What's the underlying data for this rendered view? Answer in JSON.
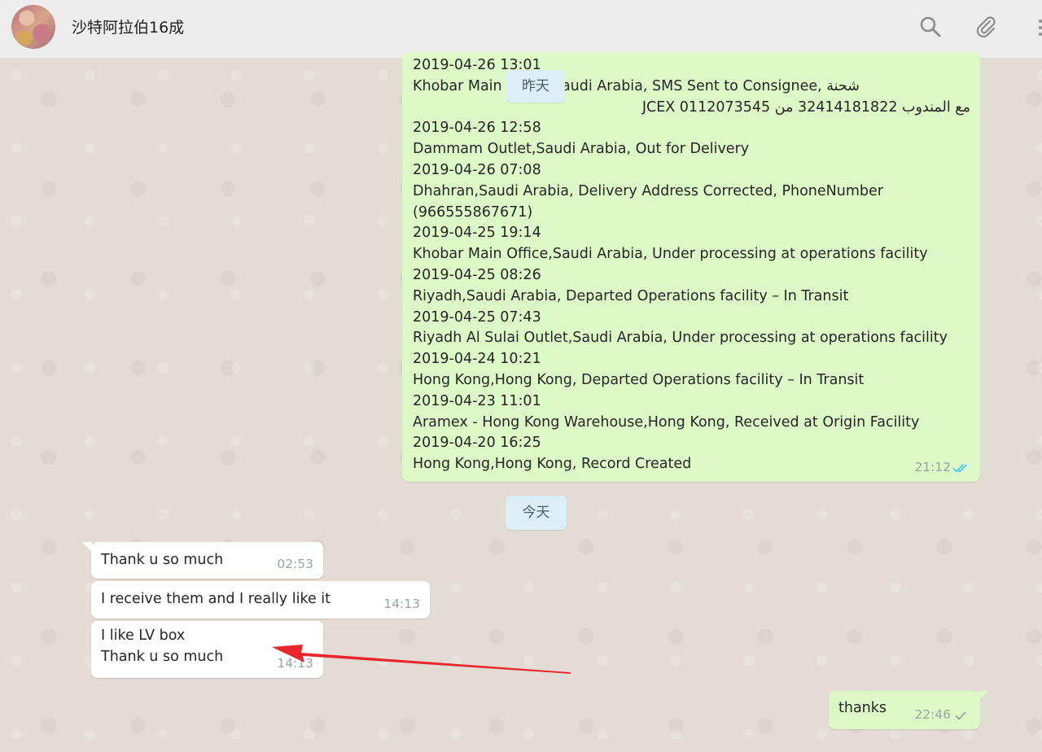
{
  "header": {
    "contact_name": "沙特阿拉伯16成",
    "icons": [
      "search-icon",
      "attach-icon"
    ]
  },
  "date_chips": {
    "yesterday": "昨天",
    "today": "今天"
  },
  "tracking_message": {
    "lines": [
      "2019-04-26 13:01",
      "Khobar Main Office,Saudi Arabia, SMS Sent to Consignee, شحنة",
      "مع المندوب 32414181822 من JCEX 0112073545",
      "2019-04-26 12:58",
      "Dammam Outlet,Saudi Arabia, Out for Delivery",
      "2019-04-26 07:08",
      "Dhahran,Saudi Arabia, Delivery Address Corrected, PhoneNumber",
      "(966555867671)",
      "2019-04-25 19:14",
      "Khobar Main Office,Saudi Arabia, Under processing at operations facility",
      "2019-04-25 08:26",
      "Riyadh,Saudi Arabia, Departed Operations facility – In Transit",
      "2019-04-25 07:43",
      "Riyadh Al Sulai Outlet,Saudi Arabia, Under processing at operations facility",
      "2019-04-24 10:21",
      "Hong Kong,Hong Kong, Departed Operations facility – In Transit",
      "2019-04-23 11:01",
      "Aramex - Hong Kong Warehouse,Hong Kong, Received at Origin Facility",
      "2019-04-20 16:25",
      "Hong Kong,Hong Kong, Record Created"
    ],
    "time": "21:12",
    "status": "read"
  },
  "incoming": [
    {
      "lines": [
        "Thank u so much"
      ],
      "time": "02:53"
    },
    {
      "lines": [
        "I receive them and I really like it"
      ],
      "time": "14:13"
    },
    {
      "lines": [
        "I like LV box",
        "Thank u so much"
      ],
      "time": "14:13"
    }
  ],
  "outgoing_last": {
    "text": "thanks",
    "time": "22:46",
    "status": "sent"
  },
  "colors": {
    "outgoing_bubble": "#dcf8c6",
    "incoming_bubble": "#ffffff",
    "annotation_arrow": "#e8262b",
    "read_tick": "#4fc3f7"
  }
}
